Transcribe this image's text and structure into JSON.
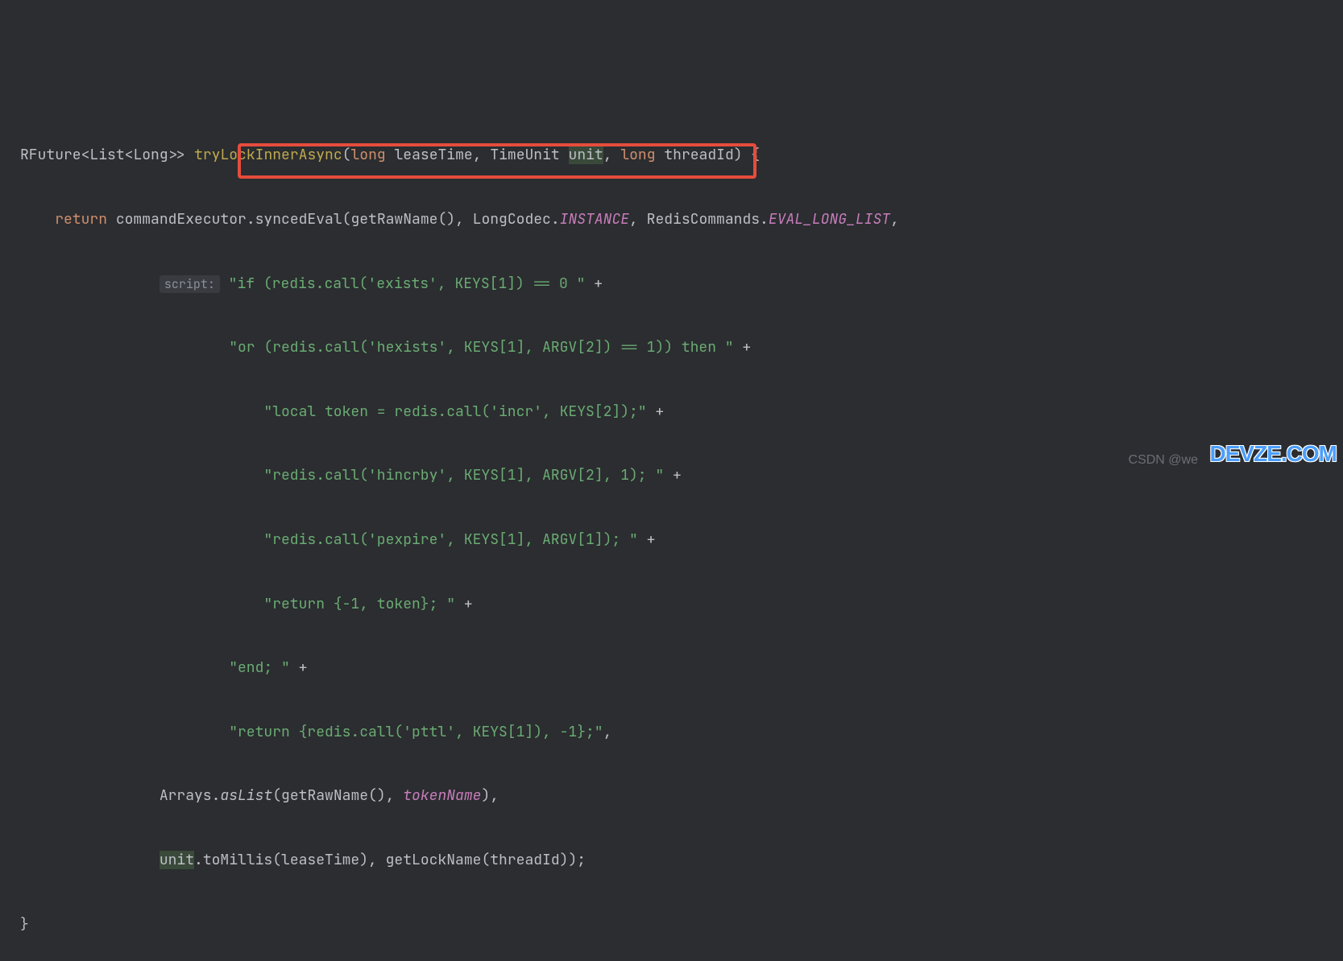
{
  "code": {
    "line1": {
      "type1": "RFuture",
      "lt1": "<",
      "type2": "List",
      "lt2": "<",
      "type3": "Long",
      "gt": ">>",
      "method": "tryLockInnerAsync",
      "lparen": "(",
      "kw_long1": "long",
      "param1": "leaseTime",
      "comma1": ", ",
      "type4": "TimeUnit ",
      "param2": "unit",
      "comma2": ", ",
      "kw_long2": "long",
      "param3": "threadId",
      "rparen": ") {"
    },
    "line2": {
      "indent": "    ",
      "kw_return": "return",
      "obj": " commandExecutor.",
      "method": "syncedEval",
      "lparen": "(",
      "call1": "getRawName",
      "paren1": "(), ",
      "type1": "LongCodec.",
      "const1": "INSTANCE",
      "comma1": ", ",
      "type2": "RedisCommands.",
      "const2": "EVAL_LONG_LIST",
      "comma2": ","
    },
    "line3": {
      "indent": "                ",
      "hint": "script:",
      "str": "\"if (redis.call('exists', KEYS[1]) == 0 \"",
      "plus": " +"
    },
    "line4": {
      "indent": "                        ",
      "str": "\"or (redis.call('hexists', KEYS[1], ARGV[2]) == 1)) then \"",
      "plus": " +"
    },
    "line5": {
      "indent": "                            ",
      "str": "\"local token = redis.call('incr', KEYS[2]);\"",
      "plus": " +"
    },
    "line6": {
      "indent": "                            ",
      "str": "\"redis.call('hincrby', KEYS[1], ARGV[2], 1); \"",
      "plus": " +"
    },
    "line7": {
      "indent": "                            ",
      "str": "\"redis.call('pexpire', KEYS[1], ARGV[1]); \"",
      "plus": " +"
    },
    "line8": {
      "indent": "                            ",
      "str": "\"return {-1, token}; \"",
      "plus": " +"
    },
    "line9": {
      "indent": "                        ",
      "str": "\"end; \"",
      "plus": " +"
    },
    "line10": {
      "indent": "                        ",
      "str": "\"return {redis.call('pttl', KEYS[1]), -1};\"",
      "comma": ","
    },
    "line11": {
      "indent": "                ",
      "type": "Arrays.",
      "method": "asList",
      "lparen": "(",
      "call1": "getRawName",
      "paren1": "(), ",
      "var": "tokenName",
      "rparen": "),"
    },
    "line12": {
      "indent": "                ",
      "var": "unit",
      "method1": ".toMillis(",
      "param": "leaseTime",
      "close1": "), ",
      "call2": "getLockName",
      "open2": "(",
      "param2": "threadId",
      "close2": "));"
    },
    "line13": {
      "text": "}"
    }
  },
  "watermark": {
    "csdn": "CSDN @we",
    "devze": "DEVZE.COM"
  }
}
